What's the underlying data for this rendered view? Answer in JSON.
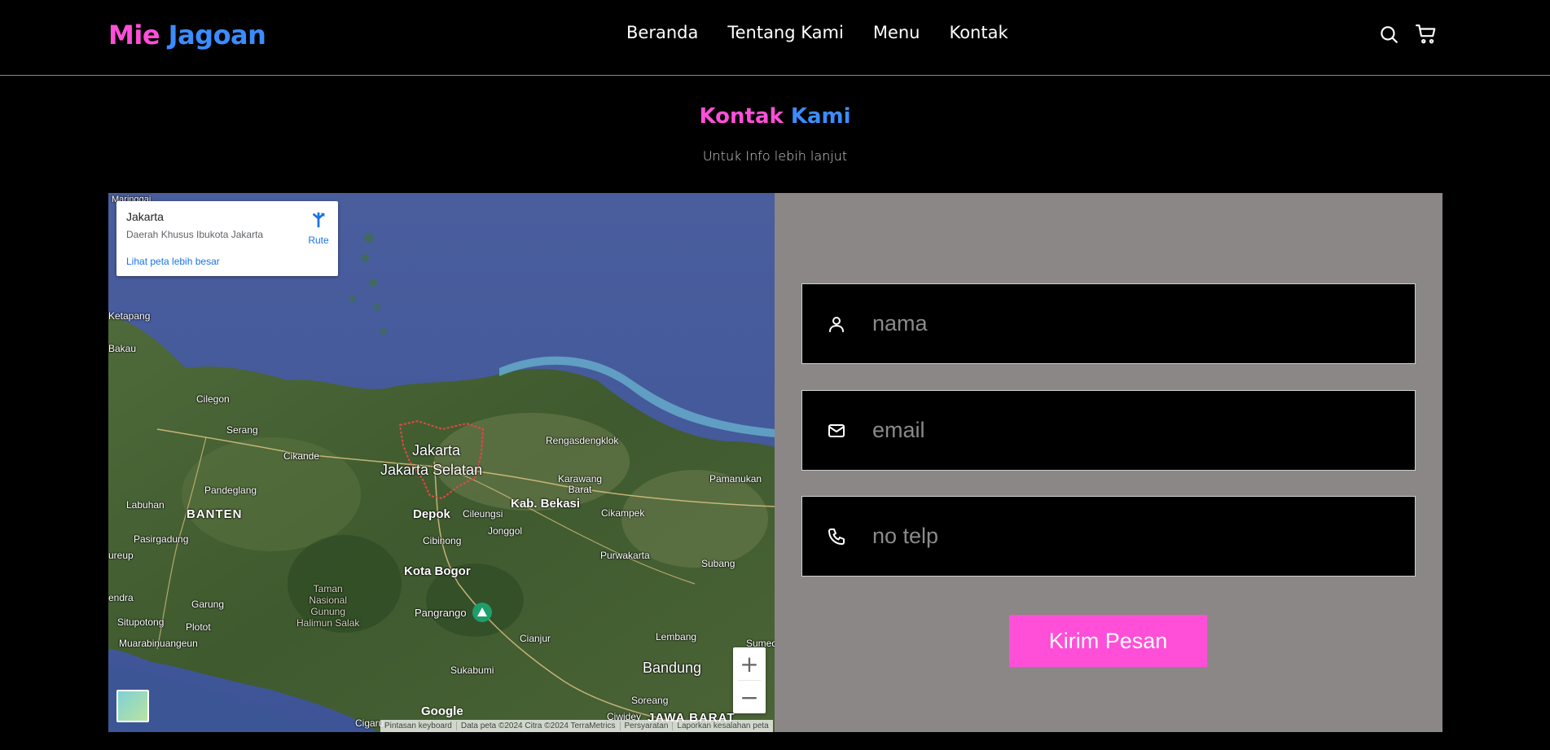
{
  "logo": {
    "part1": "Mie",
    "part2": "Jagoan"
  },
  "nav": {
    "links": [
      "Beranda",
      "Tentang Kami",
      "Menu",
      "Kontak"
    ]
  },
  "heading": {
    "part1": "Kontak",
    "part2": "Kami",
    "subtitle": "Untuk Info lebih lanjut"
  },
  "map": {
    "info_card": {
      "place": "Jakarta",
      "region": "Daerah Khusus Ibukota Jakarta",
      "larger_map": "Lihat peta lebih besar",
      "route": "Rute"
    },
    "labels": {
      "jakarta": "Jakarta",
      "jakarta_selatan": "Jakarta Selatan",
      "banten": "BANTEN",
      "depok": "Depok",
      "bekasi": "Kab. Bekasi",
      "bogor": "Kota Bogor",
      "bandung": "Bandung",
      "jawa_barat": "JAWA BARAT",
      "serang": "Serang",
      "cilegon": "Cilegon",
      "cikande": "Cikande",
      "pandeglang": "Pandeglang",
      "labuhan": "Labuhan",
      "pasirgadung": "Pasirgadung",
      "garung": "Garung",
      "situpotong": "Situpotong",
      "plotot": "Plotot",
      "muarabinuangeun": "Muarabinuangeun",
      "taman": "Taman\nNasional\nGunung\nHalimun Salak",
      "pangrango": "Pangrango",
      "cianjur": "Cianjur",
      "sukabumi": "Sukabumi",
      "lembang": "Lembang",
      "subang": "Subang",
      "purwakarta": "Purwakarta",
      "cikampek": "Cikampek",
      "karawang": "Karawang\nBarat",
      "rengasdengklok": "Rengasdengklok",
      "pamanukan": "Pamanukan",
      "cileungsi": "Cileungsi",
      "jonggol": "Jonggol",
      "cibinong": "Cibinong",
      "ketapang": "Ketapang",
      "bakau": "Bakau",
      "soreang": "Soreang",
      "ciwidey": "Ciwidey",
      "cigaru": "Cigaru",
      "sumed": "Sumed",
      "ureup": "ureup",
      "endra": "endra",
      "maringgai": "Maringgai"
    },
    "google": "Google",
    "attribution": [
      "Pintasan keyboard",
      "Data peta ©2024 Citra ©2024 TerraMetrics",
      "Persyaratan",
      "Laporkan kesalahan peta"
    ],
    "zoom_in": "+",
    "zoom_out": "−"
  },
  "form": {
    "name_placeholder": "nama",
    "email_placeholder": "email",
    "phone_placeholder": "no telp",
    "submit": "Kirim Pesan"
  },
  "colors": {
    "pink": "#ff4fd8",
    "blue": "#3b8cff",
    "panel": "#8a8786"
  }
}
